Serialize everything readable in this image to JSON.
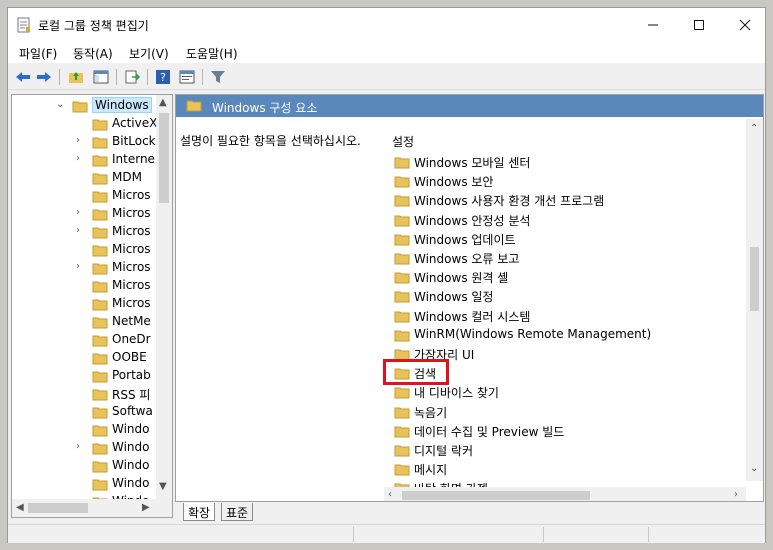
{
  "window": {
    "title": "로컬 그룹 정책 편집기"
  },
  "menu": [
    "파일(F)",
    "동작(A)",
    "보기(V)",
    "도움말(H)"
  ],
  "tree": {
    "selected": "Windows",
    "items": [
      {
        "label": "Windows",
        "expander": "⌄",
        "level": 0
      },
      {
        "label": "ActiveX",
        "expander": "",
        "level": 1
      },
      {
        "label": "BitLock",
        "expander": "›",
        "level": 1
      },
      {
        "label": "Interne",
        "expander": "›",
        "level": 1
      },
      {
        "label": "MDM",
        "expander": "",
        "level": 1
      },
      {
        "label": "Micros",
        "expander": "",
        "level": 1
      },
      {
        "label": "Micros",
        "expander": "›",
        "level": 1
      },
      {
        "label": "Micros",
        "expander": "›",
        "level": 1
      },
      {
        "label": "Micros",
        "expander": "",
        "level": 1
      },
      {
        "label": "Micros",
        "expander": "›",
        "level": 1
      },
      {
        "label": "Micros",
        "expander": "",
        "level": 1
      },
      {
        "label": "Micros",
        "expander": "",
        "level": 1
      },
      {
        "label": "NetMe",
        "expander": "",
        "level": 1
      },
      {
        "label": "OneDr",
        "expander": "",
        "level": 1
      },
      {
        "label": "OOBE",
        "expander": "",
        "level": 1
      },
      {
        "label": "Portab",
        "expander": "",
        "level": 1
      },
      {
        "label": "RSS 피",
        "expander": "",
        "level": 1
      },
      {
        "label": "Softwa",
        "expander": "",
        "level": 1
      },
      {
        "label": "Windo",
        "expander": "",
        "level": 1
      },
      {
        "label": "Windo",
        "expander": "›",
        "level": 1
      },
      {
        "label": "Windo",
        "expander": "",
        "level": 1
      },
      {
        "label": "Windo",
        "expander": "",
        "level": 1
      },
      {
        "label": "Windo",
        "expander": "",
        "level": 1
      }
    ]
  },
  "right": {
    "header": "Windows 구성 요소",
    "description": "설명이 필요한 항목을 선택하십시오.",
    "settings_header": "설정",
    "items": [
      "Windows 모바일 센터",
      "Windows 보안",
      "Windows 사용자 환경 개선 프로그램",
      "Windows 안정성 분석",
      "Windows 업데이트",
      "Windows 오류 보고",
      "Windows 원격 셸",
      "Windows 일정",
      "Windows 컬러 시스템",
      "WinRM(Windows Remote Management)",
      "가장자리 UI",
      "검색",
      "내 디바이스 찾기",
      "녹음기",
      "데이터 수집 및 Preview 빌드",
      "디지털 락커",
      "메시지",
      "바탕 화면 가젯"
    ],
    "highlighted_item": "검색"
  },
  "tabs": [
    "확장",
    "표준"
  ],
  "colors": {
    "header_bg": "#5a88bc",
    "highlight": "#e0121e",
    "folder": "#e8c35a"
  }
}
